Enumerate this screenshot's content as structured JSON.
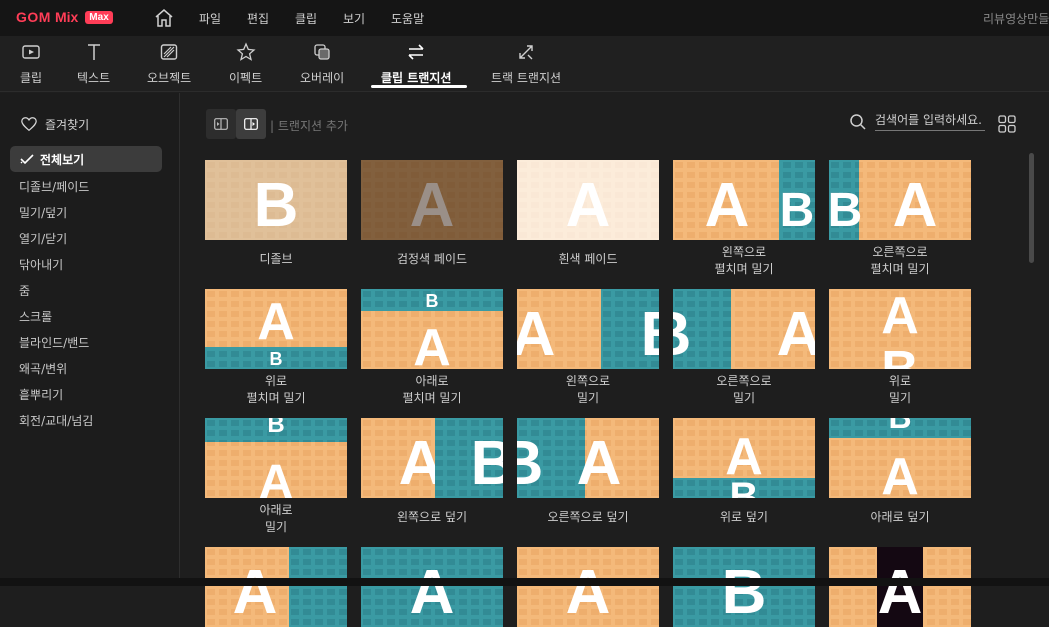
{
  "app": {
    "brand_gom": "GOM",
    "brand_mix": "Mix",
    "brand_max": "Max",
    "project_title": "리뷰영상만들"
  },
  "menu": [
    "파일",
    "편집",
    "클립",
    "보기",
    "도움말"
  ],
  "tools": [
    {
      "label": "클립",
      "icon": "clip-icon"
    },
    {
      "label": "텍스트",
      "icon": "text-icon"
    },
    {
      "label": "오브젝트",
      "icon": "object-icon"
    },
    {
      "label": "이펙트",
      "icon": "effect-icon"
    },
    {
      "label": "오버레이",
      "icon": "overlay-icon"
    },
    {
      "label": "클립 트랜지션",
      "icon": "clip-transition-icon",
      "active": true
    },
    {
      "label": "트랙 트랜지션",
      "icon": "track-transition-icon"
    }
  ],
  "sidebar": {
    "favorites": "즐겨찾기",
    "all": "전체보기",
    "categories": [
      "디졸브/페이드",
      "밀기/덮기",
      "열기/닫기",
      "닦아내기",
      "줌",
      "스크롤",
      "블라인드/밴드",
      "왜곡/변위",
      "흩뿌리기",
      "회전/교대/넘김"
    ]
  },
  "main": {
    "add_label": "| 트랜지션 추가",
    "search_placeholder": "검색어를 입력하세요."
  },
  "transitions": [
    [
      "디졸브"
    ],
    [
      "검정색 페이드"
    ],
    [
      "흰색 페이드"
    ],
    [
      "왼쪽으로",
      "펼치며 밀기"
    ],
    [
      "오른쪽으로",
      "펼치며 밀기"
    ],
    [
      "위로",
      "펼치며 밀기"
    ],
    [
      "아래로",
      "펼치며 밀기"
    ],
    [
      "왼쪽으로",
      "밀기"
    ],
    [
      "오른쪽으로",
      "밀기"
    ],
    [
      "위로",
      "밀기"
    ],
    [
      "아래로",
      "밀기"
    ],
    [
      "왼쪽으로 덮기"
    ],
    [
      "오른쪽으로 덮기"
    ],
    [
      "위로 덮기"
    ],
    [
      "아래로 덮기"
    ]
  ],
  "colors": {
    "orange": "#f4b97a",
    "teal": "#3a9aa3",
    "accent": "#ff3d57"
  }
}
